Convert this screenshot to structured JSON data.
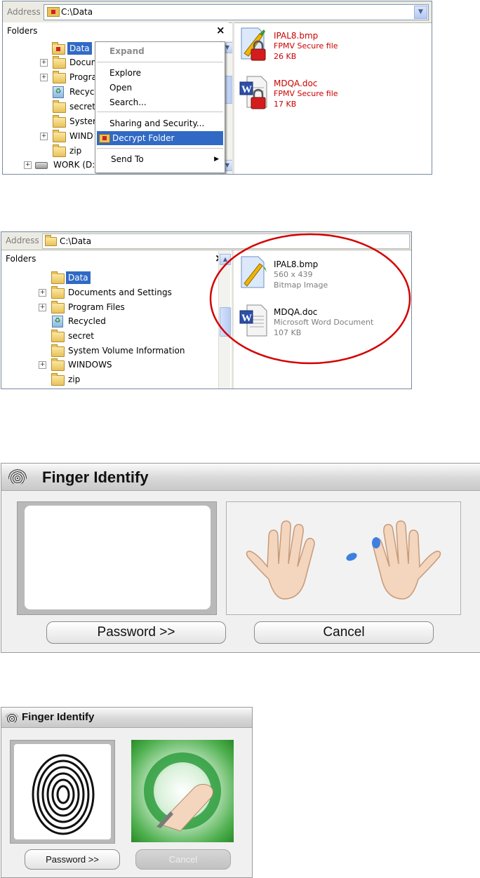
{
  "window1": {
    "address_label": "Address",
    "address_value": "C:\\Data",
    "folders_title": "Folders",
    "tree": [
      {
        "label": "Data",
        "selected": true,
        "icon": "secure-folder-icon"
      },
      {
        "label": "Docum",
        "expandable": true,
        "icon": "folder-icon"
      },
      {
        "label": "Progra",
        "expandable": true,
        "icon": "folder-icon"
      },
      {
        "label": "Recyc",
        "icon": "recycle-bin-icon"
      },
      {
        "label": "secret",
        "icon": "folder-icon"
      },
      {
        "label": "Syster",
        "icon": "folder-icon"
      },
      {
        "label": "WIND",
        "expandable": true,
        "icon": "folder-icon"
      },
      {
        "label": "zip",
        "icon": "folder-icon"
      },
      {
        "label": "WORK (D:",
        "expandable": true,
        "icon": "drive-icon"
      }
    ],
    "context_menu": {
      "items": [
        "Expand",
        "Explore",
        "Open",
        "Search...",
        "Sharing and Security...",
        "Decrypt Folder",
        "Send To"
      ],
      "highlighted": "Decrypt Folder"
    },
    "files": [
      {
        "name": "IPAL8.bmp",
        "type": "FPMV Secure file",
        "size": "26 KB",
        "icon": "locked-paint-file-icon"
      },
      {
        "name": "MDQA.doc",
        "type": "FPMV Secure file",
        "size": "17 KB",
        "icon": "locked-word-file-icon"
      }
    ],
    "secure_text_color": "#cc0000"
  },
  "window2": {
    "address_label": "Address",
    "address_value": "C:\\Data",
    "folders_title": "Folders",
    "tree": [
      {
        "label": "Data",
        "selected": true
      },
      {
        "label": "Documents and Settings",
        "expandable": true
      },
      {
        "label": "Program Files",
        "expandable": true
      },
      {
        "label": "Recycled",
        "icon": "recycle-bin-icon"
      },
      {
        "label": "secret"
      },
      {
        "label": "System Volume Information"
      },
      {
        "label": "WINDOWS",
        "expandable": true
      },
      {
        "label": "zip"
      }
    ],
    "files": [
      {
        "name": "IPAL8.bmp",
        "line2": "560 x 439",
        "line3": "Bitmap Image",
        "icon": "paint-file-icon"
      },
      {
        "name": "MDQA.doc",
        "line2": "Microsoft Word Document",
        "line3": "107 KB",
        "icon": "word-file-icon"
      }
    ],
    "highlight_color": "#d40000"
  },
  "dialog1": {
    "title": "Finger Identify",
    "password_button": "Password >>",
    "cancel_button": "Cancel",
    "highlighted_finger_color": "#3f7fe0"
  },
  "dialog2": {
    "title": "Finger Identify",
    "password_button": "Password >>",
    "cancel_button": "Cancel",
    "cancel_enabled": false
  },
  "colors": {
    "selection": "#316ac5",
    "menu_highlight": "#316ac5"
  }
}
